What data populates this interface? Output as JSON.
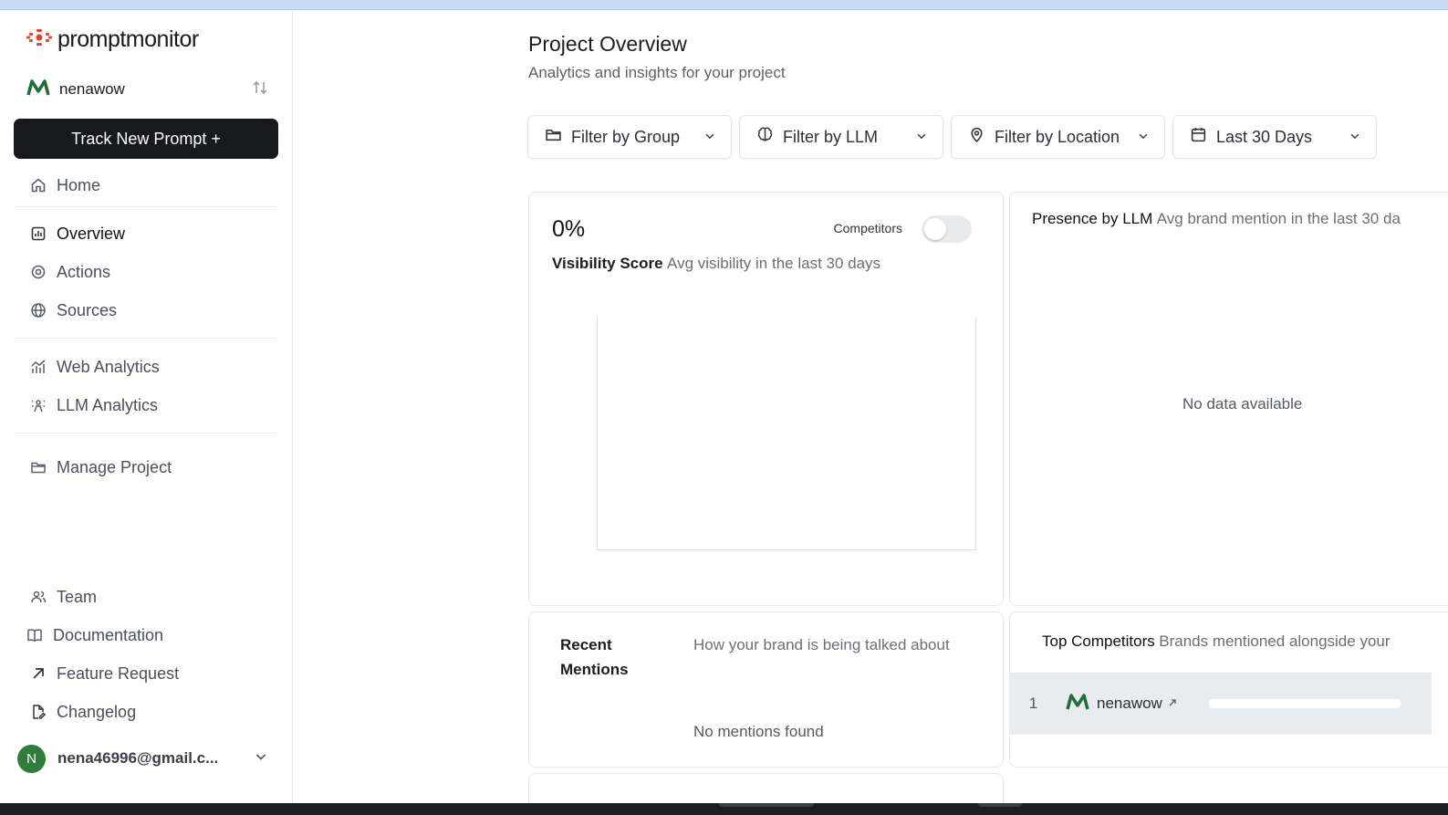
{
  "brand": {
    "logo_text": "promptmonitor",
    "accent": "#e8452c"
  },
  "project": {
    "name": "nenawow",
    "color": "#1f6e3a"
  },
  "sidebar": {
    "track_button": "Track New Prompt +",
    "group1": [
      {
        "label": "Home",
        "icon": "home-icon"
      }
    ],
    "group2": [
      {
        "label": "Overview",
        "icon": "bar-chart-icon"
      },
      {
        "label": "Actions",
        "icon": "target-icon"
      },
      {
        "label": "Sources",
        "icon": "globe-icon"
      }
    ],
    "group3": [
      {
        "label": "Web Analytics",
        "icon": "analytics-icon"
      },
      {
        "label": "LLM Analytics",
        "icon": "sparkle-person-icon"
      }
    ],
    "group4": [
      {
        "label": "Manage Project",
        "icon": "folder-icon"
      }
    ],
    "bottom": [
      {
        "label": "Team",
        "icon": "users-icon"
      },
      {
        "label": "Documentation",
        "icon": "book-icon"
      },
      {
        "label": "Feature Request",
        "icon": "arrow-up-right-icon"
      },
      {
        "label": "Changelog",
        "icon": "file-edit-icon"
      }
    ],
    "user": {
      "initial": "N",
      "email": "nena46996@gmail.c..."
    }
  },
  "main": {
    "title": "Project Overview",
    "subtitle": "Analytics and insights for your project",
    "filters": {
      "group": "Filter by Group",
      "llm": "Filter by LLM",
      "location": "Filter by Location",
      "date": "Last 30 Days"
    },
    "visibility": {
      "score": "0%",
      "competitors_label": "Competitors",
      "competitors_on": false,
      "title": "Visibility Score",
      "desc": "Avg visibility in the last 30 days"
    },
    "presence": {
      "title": "Presence by LLM",
      "desc": "Avg brand mention in the last 30 da",
      "empty": "No data available"
    },
    "mentions": {
      "title": "Recent Mentions",
      "desc": "How your brand is being talked about",
      "empty": "No mentions found"
    },
    "competitors": {
      "title": "Top Competitors",
      "desc": "Brands mentioned alongside your",
      "rows": [
        {
          "rank": "1",
          "name": "nenawow"
        }
      ]
    }
  }
}
